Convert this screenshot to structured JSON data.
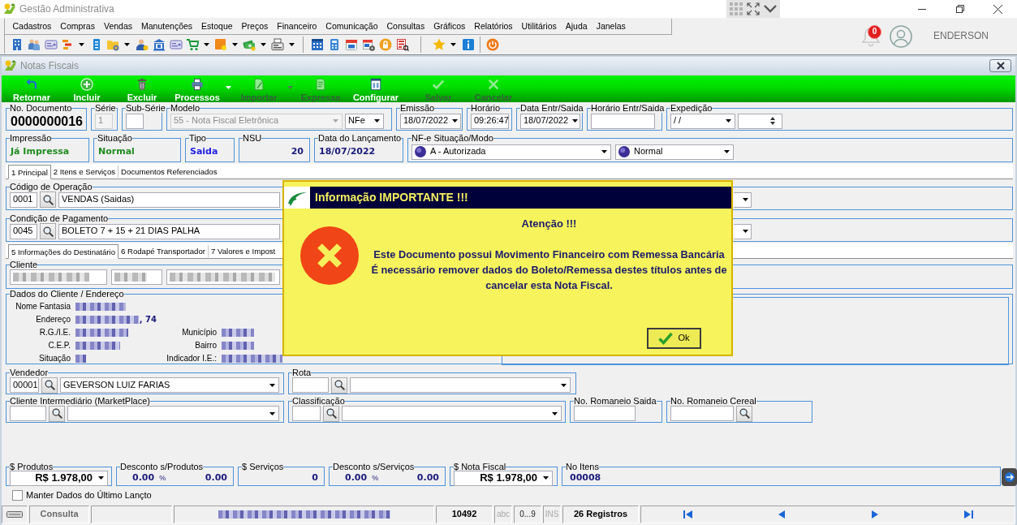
{
  "window": {
    "title": "Gestão Administrativa"
  },
  "menu": [
    "Cadastros",
    "Compras",
    "Vendas",
    "Manutenções",
    "Estoque",
    "Preços",
    "Financeiro",
    "Comunicação",
    "Consultas",
    "Gráficos",
    "Relatórios",
    "Utilitários",
    "Ajuda",
    "Janelas"
  ],
  "toolbar": {
    "groups": [
      [
        {
          "dropdown": false
        },
        {
          "dropdown": false
        },
        {
          "dropdown": false
        },
        {
          "dropdown": true
        },
        {
          "dropdown": false
        },
        {
          "dropdown": true
        },
        {
          "dropdown": false
        },
        {
          "dropdown": false
        },
        {
          "dropdown": false
        },
        {
          "dropdown": true
        },
        {
          "dropdown": true
        },
        {
          "dropdown": true
        },
        {
          "dropdown": true
        }
      ],
      [
        {
          "dropdown": false
        },
        {
          "dropdown": false
        },
        {
          "dropdown": false
        },
        {
          "dropdown": false
        },
        {
          "dropdown": false
        },
        {
          "dropdown": false
        }
      ],
      [
        {
          "dropdown": true
        },
        {
          "dropdown": false
        }
      ],
      [
        {
          "dropdown": false
        }
      ]
    ]
  },
  "notifications": {
    "count": "0"
  },
  "user": {
    "name": "ENDERSON"
  },
  "form_window": {
    "title": "Notas Fiscais"
  },
  "actions": [
    {
      "label": "Retornar",
      "disabled": false,
      "dropdown": false
    },
    {
      "label": "Incluir",
      "disabled": false,
      "dropdown": false
    },
    {
      "label": "Excluir",
      "disabled": false,
      "dropdown": false
    },
    {
      "label": "Processos",
      "disabled": false,
      "dropdown": true
    },
    {
      "label": "Importar",
      "disabled": true,
      "dropdown": true
    },
    {
      "label": "Expressa",
      "disabled": true,
      "dropdown": false
    },
    {
      "label": "Configurar",
      "disabled": false,
      "dropdown": false
    },
    {
      "label": "Salvar",
      "disabled": true,
      "dropdown": false
    },
    {
      "label": "Cancelar",
      "disabled": true,
      "dropdown": false
    }
  ],
  "document": {
    "numero": {
      "label": "No. Documento",
      "value": "0000000016"
    },
    "serie": {
      "label": "Série",
      "value": "1",
      "disabled": true
    },
    "sub_serie": {
      "label": "Sub-Série"
    },
    "modelo": {
      "label": "Modelo",
      "value": "55 - Nota Fiscal Eletrônica",
      "disabled": true,
      "tipo": "NFe"
    },
    "emissao": {
      "label": "Emissão",
      "value": "18/07/2022"
    },
    "horario": {
      "label": "Horário",
      "value": "09:26:47"
    },
    "data_entr_saida": {
      "label": "Data Entr/Saida",
      "value": "18/07/2022"
    },
    "horario_entr_saida": {
      "label": "Horário Entr/Saida"
    },
    "expedicao": {
      "label": "Expedição",
      "value": "/ /"
    }
  },
  "status": {
    "impressao": {
      "label": "Impressão",
      "value": "Já Impressa"
    },
    "situacao": {
      "label": "Situação",
      "value": "Normal"
    },
    "tipo": {
      "label": "Tipo",
      "value": "Saida"
    },
    "nsu": {
      "label": "NSU",
      "value": "20"
    },
    "data_lancamento": {
      "label": "Data do Lançamento",
      "value": "18/07/2022"
    },
    "nfe": {
      "label": "NF-e Situação/Modo",
      "situacao": "A - Autorizada",
      "modo": "Normal"
    }
  },
  "tabs": [
    {
      "label": "1 Principal",
      "selected": true
    },
    {
      "label": "2 Itens e Serviços",
      "selected": false
    },
    {
      "label": "Documentos Referenciados",
      "selected": false
    }
  ],
  "operacao": {
    "label": "Código de Operação",
    "code": "0001",
    "value": "VENDAS (Saidas)"
  },
  "pagamento": {
    "label": "Condição de Pagamento",
    "code": "0045",
    "value": "BOLETO 7 + 15 + 21 DIAS PALHA"
  },
  "sub_tabs": [
    {
      "label": "5 Informações do Destinatário",
      "selected": true
    },
    {
      "label": "6 Rodapé Transportador",
      "selected": false
    },
    {
      "label": "7 Valores e Impost",
      "selected": false
    }
  ],
  "cliente": {
    "label": "Cliente",
    "fields": [
      {
        "redacted": true
      },
      {
        "redacted": true
      },
      {
        "redacted": true
      }
    ]
  },
  "dados_cliente": {
    "label": "Dados do Cliente / Endereço",
    "left": [
      {
        "label": "Nome Fantasia",
        "redacted": true
      },
      {
        "label": "Endereço",
        "redacted": true,
        "value": ", 74"
      },
      {
        "label": "R.G./I.E.",
        "redacted": true
      },
      {
        "label": "C.E.P.",
        "redacted": true
      },
      {
        "label": "Situação",
        "redacted": true
      }
    ],
    "right": [
      {
        "label": "Município",
        "redacted": true
      },
      {
        "label": "Bairro",
        "redacted": true
      },
      {
        "label": "Indicador I.E.:",
        "redacted": true
      }
    ]
  },
  "vendedor": {
    "label": "Vendedor",
    "code": "00001",
    "value": "GEVERSON LUIZ FARIAS"
  },
  "rota": {
    "label": "Rota"
  },
  "cliente_intermediario": {
    "label": "Cliente Intermediário (MarketPlace)"
  },
  "classificacao": {
    "label": "Classificação"
  },
  "romaneio_saida": {
    "label": "No. Romaneio Saida"
  },
  "romaneio_cereal": {
    "label": "No. Romaneio Cereal"
  },
  "totals": {
    "produtos": {
      "label": "$ Produtos",
      "value": "R$ 1.978,00"
    },
    "desconto_produtos": {
      "label": "Desconto s/Produtos",
      "percent": "0.00",
      "unit": "%",
      "value": "0.00"
    },
    "servicos": {
      "label": "$ Serviços",
      "value": "0"
    },
    "desconto_servicos": {
      "label": "Desconto s/Serviços",
      "percent": "0.00",
      "unit": "%",
      "value": "0.00"
    },
    "nota_fiscal": {
      "label": "$ Nota Fiscal",
      "value": "R$ 1.978,00"
    },
    "itens": {
      "label": "No Itens",
      "value": "00008"
    }
  },
  "keep_last": {
    "label": "Manter Dados do Último Lançto",
    "checked": false
  },
  "status_bar": {
    "mode": "Consulta",
    "detail": {
      "redacted": true
    },
    "number": "10492",
    "indicators": [
      {
        "label": "abc",
        "on": false
      },
      {
        "label": "0...9",
        "on": true
      },
      {
        "label": "INS",
        "on": false
      }
    ],
    "records": "26 Registros"
  },
  "dialog": {
    "kind": "error",
    "title": "Informação IMPORTANTE !!!",
    "heading": "Atenção !!!",
    "lines": [
      "Este Documento possui Movimento Financeiro com Remessa Bancária",
      "É necessário remover dados do Boleto/Remessa destes títulos antes de cancelar esta Nota Fiscal."
    ],
    "button": "Ok"
  }
}
